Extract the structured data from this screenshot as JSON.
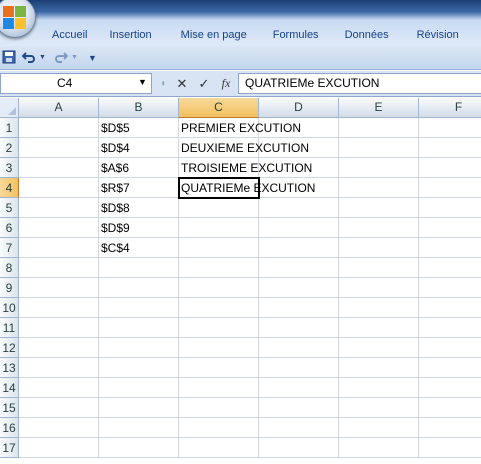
{
  "ribbon": {
    "tabs": [
      "Accueil",
      "Insertion",
      "Mise en page",
      "Formules",
      "Données",
      "Révision"
    ]
  },
  "qat": {
    "save_icon": "save-icon",
    "undo_icon": "undo-icon",
    "redo_icon": "redo-icon",
    "customize_icon": "customize-qat-icon"
  },
  "formula_bar": {
    "name_box": "C4",
    "cancel_glyph": "✕",
    "enter_glyph": "✓",
    "fx_label": "fx",
    "content": "QUATRIEMe EXCUTION"
  },
  "sheet": {
    "columns": [
      "A",
      "B",
      "C",
      "D",
      "E",
      "F"
    ],
    "rows": [
      "1",
      "2",
      "3",
      "4",
      "5",
      "6",
      "7",
      "8",
      "9",
      "10",
      "11",
      "12",
      "13",
      "14",
      "15",
      "16",
      "17"
    ],
    "active_cell": "C4",
    "cells": {
      "B1": "$D$5",
      "B2": "$D$4",
      "B3": "$A$6",
      "B4": "$R$7",
      "B5": "$D$8",
      "B6": "$D$9",
      "B7": "$C$4",
      "C1": "PREMIER EXCUTION",
      "C2": "DEUXIEME EXCUTION",
      "C3": "TROISIEME EXCUTION",
      "C4": "QUATRIEMe EXCUTION"
    }
  },
  "colors": {
    "header_active": "#f1c15f",
    "gridline": "#d0d7e5",
    "tab_text": "#15428b"
  }
}
